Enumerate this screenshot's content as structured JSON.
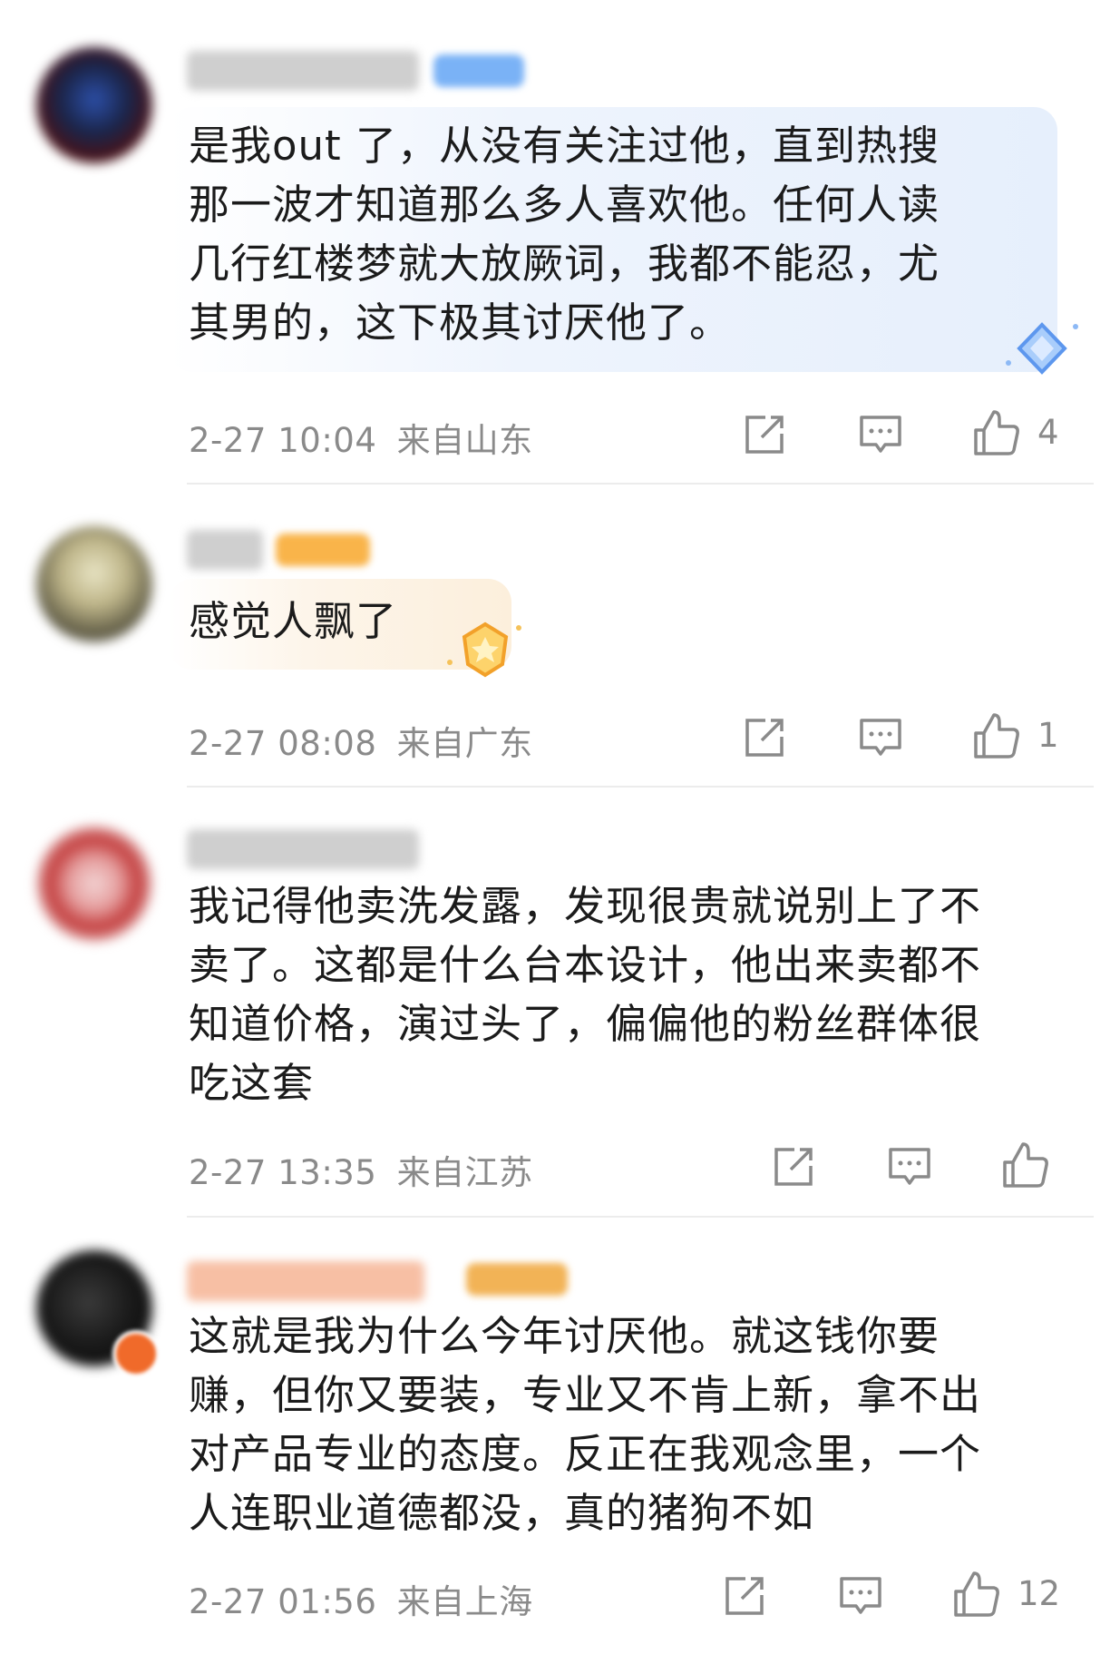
{
  "comments": [
    {
      "username": "四尖鱼四尖四",
      "text": "是我out 了，从没有关注过他，直到热搜\n那一波才知道那么多人喜欢他。任何人读\n几行红楼梦就大放厥词，我都不能忍，尤\n其男的，这下极其讨厌他了。",
      "time": "2-27 10:04",
      "location": "来自山东",
      "likes": "4",
      "badge_color": "#6aa8f5",
      "bubble_color": "#e9f1fd"
    },
    {
      "username": "阴二",
      "text": "感觉人飘了",
      "time": "2-27 08:08",
      "location": "来自广东",
      "likes": "1",
      "badge_color": "#f9b44a",
      "bubble_color": "#fdf2e2"
    },
    {
      "username": "菠萝去老肉酱",
      "text": "我记得他卖洗发露，发现很贵就说别上了不\n卖了。这都是什么台本设计，他出来卖都不\n知道价格，演过头了，偏偏他的粉丝群体很\n吃这套",
      "time": "2-27 13:35",
      "location": "来自江苏",
      "likes": ""
    },
    {
      "username": "酥酥酥酥酥的陀龙",
      "text": "这就是我为什么今年讨厌他。就这钱你要\n赚，但你又要装，专业又不肯上新，拿不出\n对产品专业的态度。反正在我观念里，一个\n人连职业道德都没，真的猪狗不如",
      "time": "2-27 01:56",
      "location": "来自上海",
      "likes": "12",
      "badge_color": "#f2b356"
    }
  ],
  "icons": {
    "share": "share-icon",
    "reply": "comment-icon",
    "like": "thumbs-up-icon"
  }
}
